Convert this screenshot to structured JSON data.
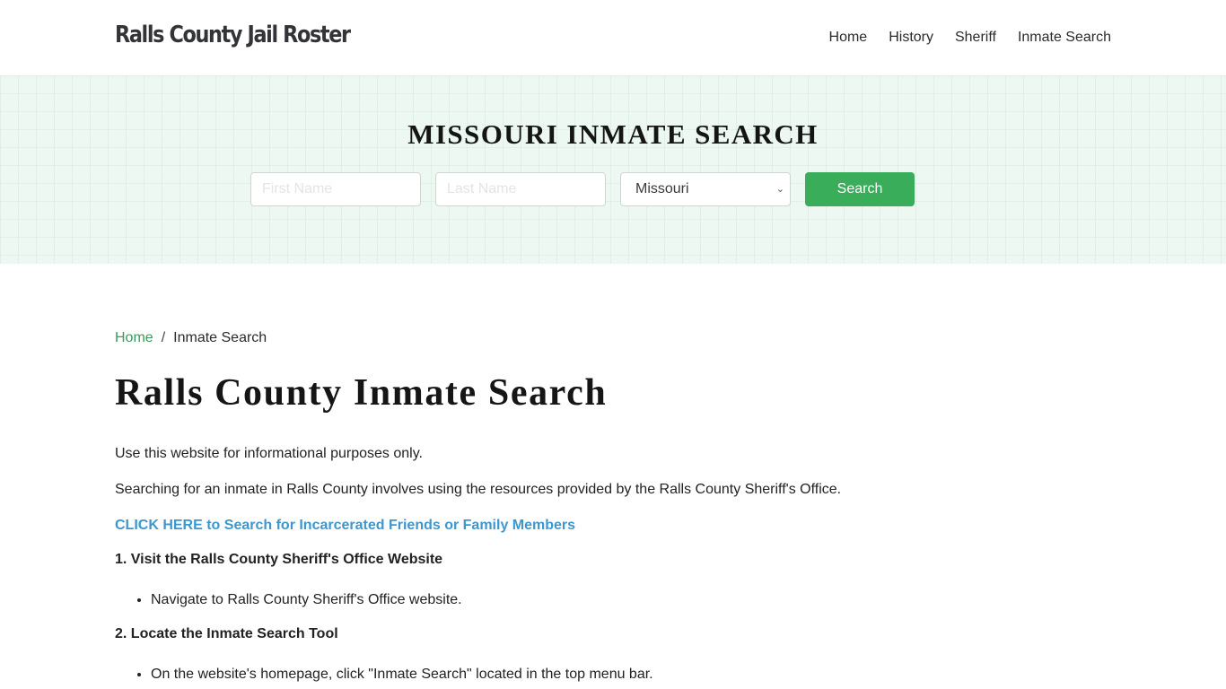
{
  "header": {
    "brand": "Ralls County Jail Roster",
    "nav": [
      {
        "label": "Home"
      },
      {
        "label": "History"
      },
      {
        "label": "Sheriff"
      },
      {
        "label": "Inmate Search"
      }
    ]
  },
  "banner": {
    "title": "MISSOURI INMATE SEARCH",
    "first_name_placeholder": "First Name",
    "last_name_placeholder": "Last Name",
    "state_selected": "Missouri",
    "search_label": "Search",
    "colors": {
      "button": "#3aad5b",
      "background": "#ecf8f1"
    }
  },
  "breadcrumb": {
    "home": "Home",
    "separator": "/",
    "current": "Inmate Search"
  },
  "main": {
    "title": "Ralls County Inmate Search",
    "intro": "Use this website for informational purposes only.",
    "description": "Searching for an inmate in Ralls County involves using the resources provided by the Ralls County Sheriff's Office.",
    "cta_link": "CLICK HERE to Search for Incarcerated Friends or Family Members",
    "steps": [
      {
        "heading": "1. Visit the Ralls County Sheriff's Office Website",
        "items": [
          "Navigate to Ralls County Sheriff's Office website."
        ]
      },
      {
        "heading": "2. Locate the Inmate Search Tool",
        "items": [
          "On the website's homepage, click \"Inmate Search\" located in the top menu bar."
        ]
      }
    ]
  }
}
